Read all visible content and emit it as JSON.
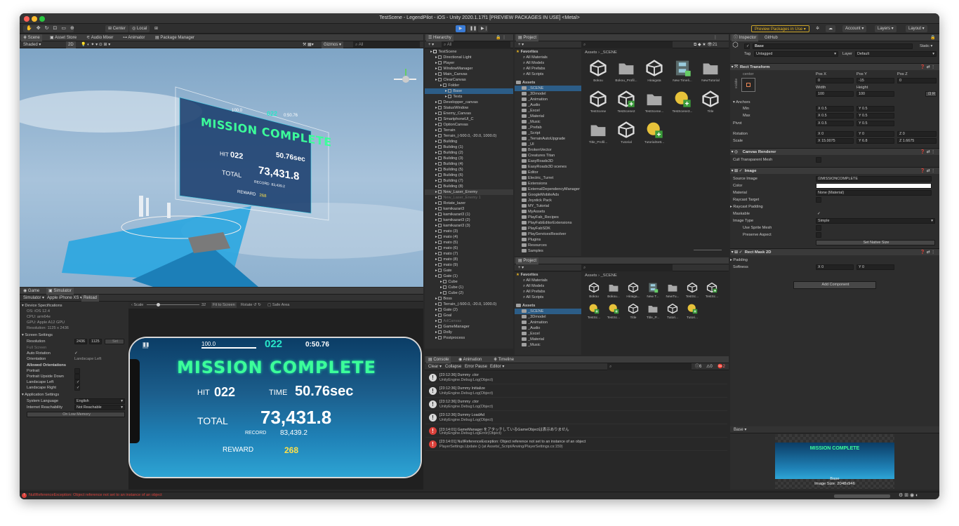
{
  "window": {
    "title": "TestScene - LegendPilot - iOS - Unity 2020.1.17f1 [PREVIEW PACKAGES IN USE] <Metal>"
  },
  "toolbar": {
    "center": "Center",
    "local": "Local",
    "preview_packages": "Preview Packages in Use",
    "account": "Account",
    "layers": "Layers",
    "layout": "Layout"
  },
  "scene_tabs": [
    "Scene",
    "Asset Store",
    "Audio Mixer",
    "Animator",
    "Package Manager"
  ],
  "scene_toolbar": {
    "shading": "Shaded",
    "mode2d": "2D",
    "gizmos": "Gizmos",
    "search": "All"
  },
  "scene_hud": {
    "bar": "100.0",
    "count": "022",
    "time": "0:50.76",
    "title": "MISSION COMPLETE",
    "hit_label": "HIT",
    "hit": "022",
    "time_label": "TIME",
    "time_value": "50.76sec",
    "total_label": "TOTAL",
    "total": "73,431.8",
    "record_label": "RECORD",
    "record": "83,439.2",
    "reward_label": "REWARD",
    "reward": "268"
  },
  "game_tabs": [
    "Game",
    "Simulator"
  ],
  "sim_toolbar": {
    "mode": "Simulator",
    "device": "Apple iPhone XS",
    "reload": "Reload",
    "scale": "Scale",
    "scale_value": "32",
    "fit": "Fit to Screen",
    "rotate": "Rotate",
    "safe": "Safe Area"
  },
  "device": {
    "header": "Device Specifications",
    "os": "OS: iOS 12.4",
    "cpu": "CPU: arm64e",
    "gpu": "GPU: Apple A12 GPU",
    "res": "Resolution: 1125 x 2436"
  },
  "screen_settings": {
    "header": "Screen Settings",
    "resolution_label": "Resolution",
    "res_w": "2436",
    "res_h": "1125",
    "set": "Set",
    "full_screen": "Full Screen",
    "auto_rotation": "Auto Rotation",
    "orientation": "Orientation",
    "orientation_value": "Landscape Left",
    "allowed": "Allowed Orientations",
    "portrait": "Portrait",
    "portrait_ud": "Portrait Upside Down",
    "landscape_left": "Landscape Left",
    "landscape_right": "Landscape Right"
  },
  "app_settings": {
    "header": "Application Settings",
    "language_label": "System Language",
    "language": "English",
    "reach_label": "Internet Reachability",
    "reach": "Not Reachable",
    "low_memory": "On Low Memory"
  },
  "hierarchy": {
    "tab": "Hierarchy",
    "search": "All",
    "items": [
      {
        "name": "TestScene",
        "d": 0
      },
      {
        "name": "Directional Light",
        "d": 1
      },
      {
        "name": "Player",
        "d": 1
      },
      {
        "name": "WindowManager",
        "d": 1
      },
      {
        "name": "Main_Canvas",
        "d": 1
      },
      {
        "name": "ClearCanvas",
        "d": 1
      },
      {
        "name": "Folder",
        "d": 2
      },
      {
        "name": "Base",
        "d": 3,
        "sel": true
      },
      {
        "name": "Texts",
        "d": 3
      },
      {
        "name": "Developper_canvas",
        "d": 1
      },
      {
        "name": "StatusWindow",
        "d": 1
      },
      {
        "name": "Enemy_Canvas",
        "d": 1
      },
      {
        "name": "SmartphoneUI_C",
        "d": 1
      },
      {
        "name": "OptionCanvas",
        "d": 1
      },
      {
        "name": "Terrain",
        "d": 1
      },
      {
        "name": "Terrain_(-500.0, -20.0, 1000.0)",
        "d": 1
      },
      {
        "name": "Building",
        "d": 1
      },
      {
        "name": "Building (1)",
        "d": 1
      },
      {
        "name": "Building (2)",
        "d": 1
      },
      {
        "name": "Building (3)",
        "d": 1
      },
      {
        "name": "Building (4)",
        "d": 1
      },
      {
        "name": "Building (5)",
        "d": 1
      },
      {
        "name": "Building (6)",
        "d": 1
      },
      {
        "name": "Building (7)",
        "d": 1
      },
      {
        "name": "Building (8)",
        "d": 1
      },
      {
        "name": "New_Laser_Enemy",
        "d": 1,
        "hl": true
      },
      {
        "name": "New_Laser_Enemy 1",
        "d": 1,
        "dim": true
      },
      {
        "name": "Rotate_lazer",
        "d": 1
      },
      {
        "name": "kamikazari3",
        "d": 1
      },
      {
        "name": "kamikazari3 (1)",
        "d": 1
      },
      {
        "name": "kamikazari3 (2)",
        "d": 1
      },
      {
        "name": "kamikazari3 (3)",
        "d": 1
      },
      {
        "name": "mato (3)",
        "d": 1
      },
      {
        "name": "mato (4)",
        "d": 1
      },
      {
        "name": "mato (5)",
        "d": 1
      },
      {
        "name": "mato (6)",
        "d": 1
      },
      {
        "name": "mato (7)",
        "d": 1
      },
      {
        "name": "mato (8)",
        "d": 1
      },
      {
        "name": "mato (9)",
        "d": 1
      },
      {
        "name": "Gate",
        "d": 1
      },
      {
        "name": "Gate (1)",
        "d": 1
      },
      {
        "name": "Cube",
        "d": 2
      },
      {
        "name": "Cube (1)",
        "d": 2
      },
      {
        "name": "Cube (2)",
        "d": 2
      },
      {
        "name": "Boss",
        "d": 1
      },
      {
        "name": "Terrain_(-500.0, -20.0, 1000.0)",
        "d": 1
      },
      {
        "name": "Gate (2)",
        "d": 1
      },
      {
        "name": "Goal",
        "d": 1
      },
      {
        "name": "AdCanvas",
        "d": 1,
        "dim": true
      },
      {
        "name": "GameManager",
        "d": 1
      },
      {
        "name": "Dolly",
        "d": 1
      },
      {
        "name": "Postprocess",
        "d": 1
      }
    ]
  },
  "project": {
    "tab": "Project",
    "favorites": "Favorites",
    "fav_items": [
      "All Materials",
      "All Models",
      "All Prefabs",
      "All Scripts"
    ],
    "assets": "Assets",
    "folders": [
      "_SCENE",
      "_3Dmodel",
      "_Animation",
      "_Audio",
      "_Excel",
      "_Material",
      "_Music",
      "_Prefab",
      "_Script",
      "_TerrainAutoUpgrade",
      "_UI",
      "BrokenVector",
      "Creatures Titan",
      "EasyRoads3D",
      "EasyRoads3D scenes",
      "Editor",
      "Electric_Turret",
      "Extensions",
      "ExternalDependencyManager",
      "GoogleMobileAds",
      "Joystick Pack",
      "MY_Tutorial",
      "MyAssets",
      "PlayFab_Recipes",
      "PlayFabEditorExtensions",
      "PlayFabSDK",
      "PlayServicesResolver",
      "Plugins",
      "Resources",
      "Samples"
    ],
    "breadcrumb_root": "Assets",
    "breadcrumb_leaf": "_SCENE",
    "badge": "21",
    "assets_grid": [
      {
        "name": "Bokou",
        "type": "unity"
      },
      {
        "name": "Bokou_Profil...",
        "type": "folder"
      },
      {
        "name": "Hiraigata",
        "type": "unity"
      },
      {
        "name": "New Timeli...",
        "type": "timeline"
      },
      {
        "name": "NewTutorial",
        "type": "folder"
      },
      {
        "name": "TestScene",
        "type": "unity"
      },
      {
        "name": "TestScene2",
        "type": "unitygreen"
      },
      {
        "name": "TestScene...",
        "type": "folder"
      },
      {
        "name": "TestScene3...",
        "type": "light"
      },
      {
        "name": "Title",
        "type": "unity"
      },
      {
        "name": "Title_Profil...",
        "type": "folder"
      },
      {
        "name": "Tutorial",
        "type": "unity"
      },
      {
        "name": "TutorialSett...",
        "type": "light"
      }
    ]
  },
  "project2": {
    "tab": "Project",
    "fav_items": [
      "All Materials",
      "All Models",
      "All Prefabs",
      "All Scripts"
    ],
    "folders": [
      "_SCENE",
      "_3Dmodel",
      "_Animation",
      "_Audio",
      "_Excel",
      "_Material",
      "_Music"
    ],
    "assets_grid": [
      {
        "name": "Bokou",
        "type": "unity"
      },
      {
        "name": "Bokou...",
        "type": "folder"
      },
      {
        "name": "Hiraiga...",
        "type": "unity"
      },
      {
        "name": "New T...",
        "type": "timeline"
      },
      {
        "name": "NewTu...",
        "type": "folder"
      },
      {
        "name": "TestSc...",
        "type": "unity"
      },
      {
        "name": "TestSc...",
        "type": "unitygreen"
      },
      {
        "name": "TestSc...",
        "type": "light"
      },
      {
        "name": "TestSc...",
        "type": "light"
      },
      {
        "name": "Title",
        "type": "unity"
      },
      {
        "name": "Title_P...",
        "type": "folder"
      },
      {
        "name": "Tutori...",
        "type": "unity"
      },
      {
        "name": "Tutori...",
        "type": "light"
      }
    ]
  },
  "console": {
    "tabs": [
      "Console",
      "Animation",
      "Timeline"
    ],
    "toolbar": [
      "Clear",
      "Collapse",
      "Error Pause",
      "Editor"
    ],
    "counts": {
      "info": "6",
      "warn": "0",
      "error": "2"
    },
    "logs": [
      {
        "kind": "info",
        "l1": "[23:12:36] Dummy .ctor",
        "l2": "UnityEngine.Debug:Log(Object)"
      },
      {
        "kind": "info",
        "l1": "[23:12:36] Dummy Initialize",
        "l2": "UnityEngine.Debug:Log(Object)"
      },
      {
        "kind": "info",
        "l1": "[23:12:36] Dummy .ctor",
        "l2": "UnityEngine.Debug:Log(Object)"
      },
      {
        "kind": "info",
        "l1": "[23:12:36] Dummy LoadAd",
        "l2": "UnityEngine.Debug:Log(Object)"
      },
      {
        "kind": "error",
        "l1": "[23:14:01] GameManager をアタッチしているGameObjectは表示ありません",
        "l2": "UnityEngine.Debug:LogError(Object)"
      },
      {
        "kind": "error",
        "l1": "[23:14:01] NullReferenceException: Object reference not set to an instance of an object",
        "l2": "PlayerSettings.Update () (at Assets/_Script/Arwing/PlayerSettings.cs:159)"
      }
    ]
  },
  "inspector": {
    "tabs": [
      "Inspector",
      "GitHub"
    ],
    "object": "Base",
    "static": "Static",
    "tag_label": "Tag",
    "tag": "Untagged",
    "layer_label": "Layer",
    "layer": "Default",
    "rect": {
      "title": "Rect Transform",
      "center": "center",
      "middle": "middle",
      "posx_l": "Pos X",
      "posy_l": "Pos Y",
      "posz_l": "Pos Z",
      "posx": "0",
      "posy": "-15",
      "posz": "0",
      "width_l": "Width",
      "height_l": "Height",
      "width": "100",
      "height": "100",
      "anchors": "Anchors",
      "min": "Min",
      "max": "Max",
      "pivot": "Pivot",
      "min_x": "0.5",
      "min_y": "0.5",
      "max_x": "0.5",
      "max_y": "0.5",
      "pivot_x": "0.5",
      "pivot_y": "0.5",
      "rotation": "Rotation",
      "rot_x": "0",
      "rot_y": "0",
      "rot_z": "0",
      "scale": "Scale",
      "sc_x": "15.0075",
      "sc_y": "6.8",
      "sc_z": "1.6675"
    },
    "canvas_renderer": {
      "title": "Canvas Renderer",
      "cull": "Cull Transparent Mesh"
    },
    "image": {
      "title": "Image",
      "source_l": "Source Image",
      "source": "MISSIONCOMPLETE",
      "color_l": "Color",
      "material_l": "Material",
      "material": "None (Material)",
      "raycast_l": "Raycast Target",
      "padding_l": "Raycast Padding",
      "maskable_l": "Maskable",
      "type_l": "Image Type",
      "type": "Simple",
      "sprite_mesh_l": "Use Sprite Mesh",
      "preserve_l": "Preserve Aspect",
      "native": "Set Native Size"
    },
    "mask": {
      "title": "Rect Mask 2D",
      "padding": "Padding",
      "softness": "Softness",
      "soft_x": "0",
      "soft_y": "0"
    },
    "add_component": "Add Component",
    "preview_label": "Base",
    "preview_title": "MISSION COMPLETE",
    "preview_name": "Base",
    "preview_size": "Image Size: 2048x946"
  },
  "status_bar": {
    "error": "NullReferenceException: Object reference not set to an instance of an object"
  }
}
